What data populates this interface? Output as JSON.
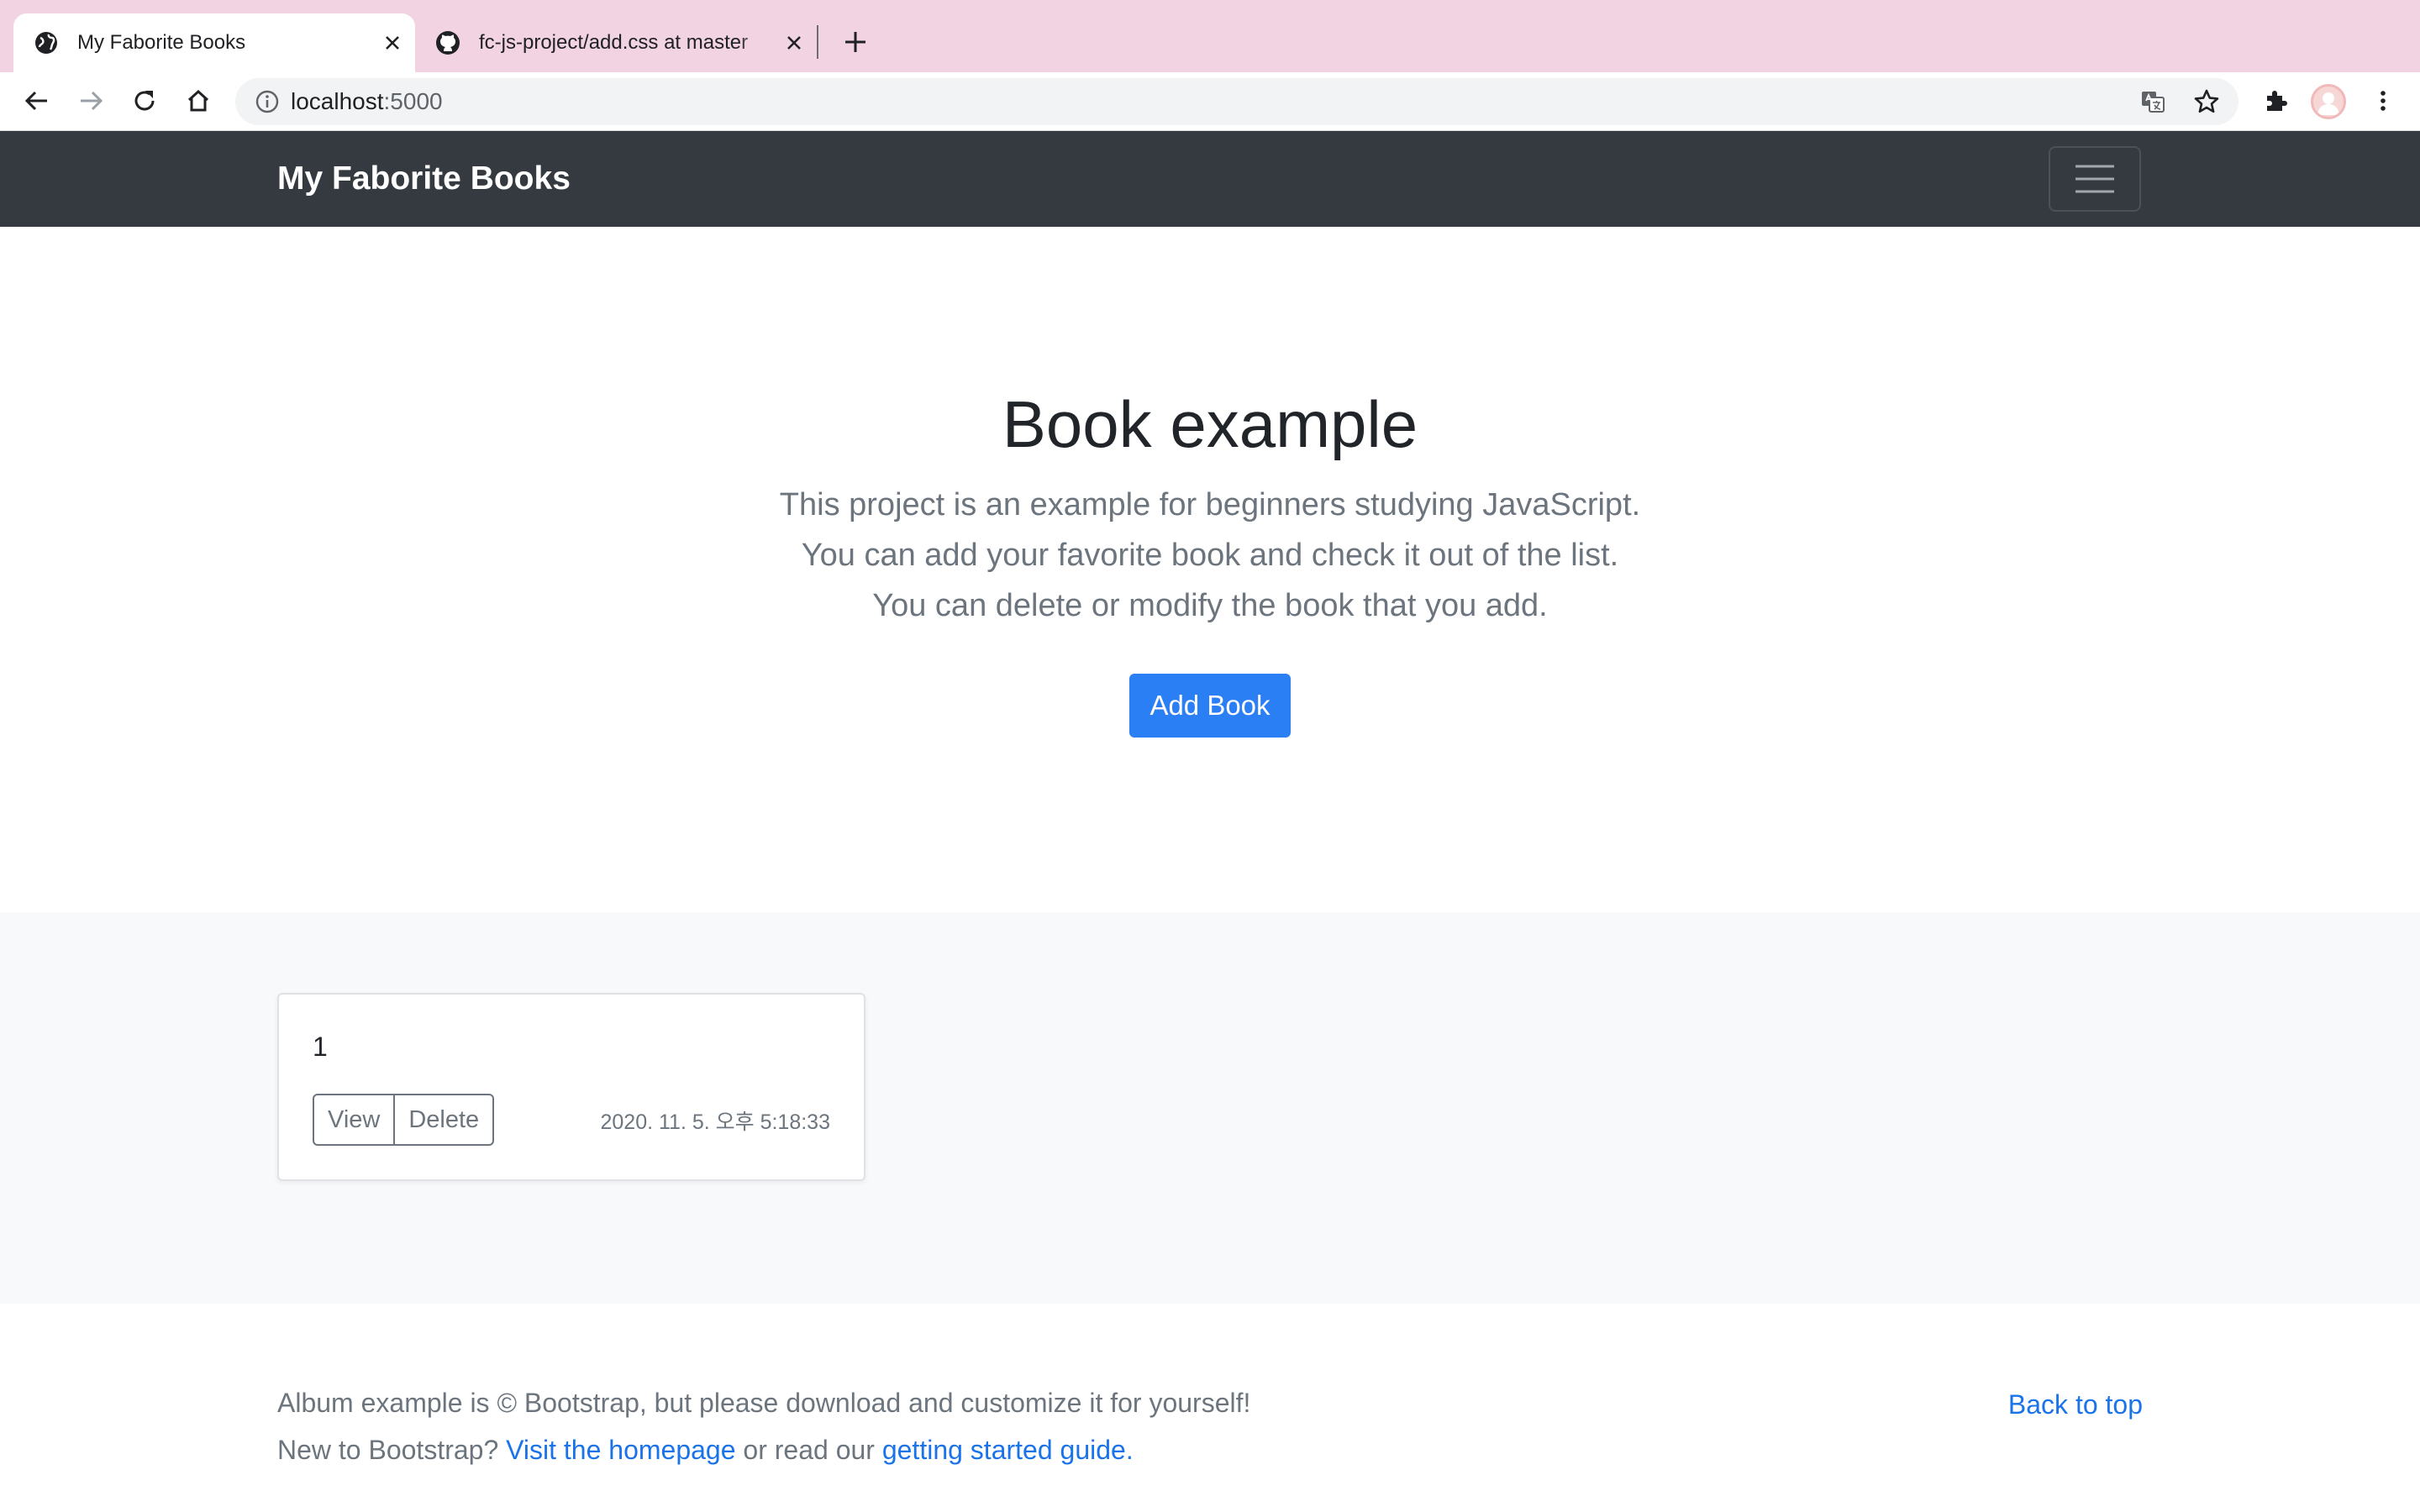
{
  "browser": {
    "tabs": [
      {
        "title": "My Faborite Books",
        "active": true,
        "icon": "globe-icon"
      },
      {
        "title": "fc-js-project/add.css at master",
        "active": false,
        "icon": "github-icon"
      }
    ],
    "url_host": "localhost",
    "url_port": ":5000"
  },
  "navbar": {
    "brand": "My Faborite Books",
    "bg_color": "#343a40"
  },
  "hero": {
    "title": "Book example",
    "lines": [
      "This project is an example for beginners studying JavaScript.",
      "You can add your favorite book and check it out of the list.",
      "You can delete or modify the book that you add."
    ],
    "add_button": "Add Book",
    "accent_color": "#2b7ff5"
  },
  "books": [
    {
      "title": "1",
      "view_label": "View",
      "delete_label": "Delete",
      "created": "2020. 11. 5. 오후 5:18:33"
    }
  ],
  "footer": {
    "line1": "Album example is © Bootstrap, but please download and customize it for yourself!",
    "line2_prefix": "New to Bootstrap? ",
    "homepage_link": "Visit the homepage",
    "line2_middle": " or read our ",
    "guide_link": "getting started guide",
    "line2_suffix": ".",
    "back_to_top": "Back to top"
  }
}
